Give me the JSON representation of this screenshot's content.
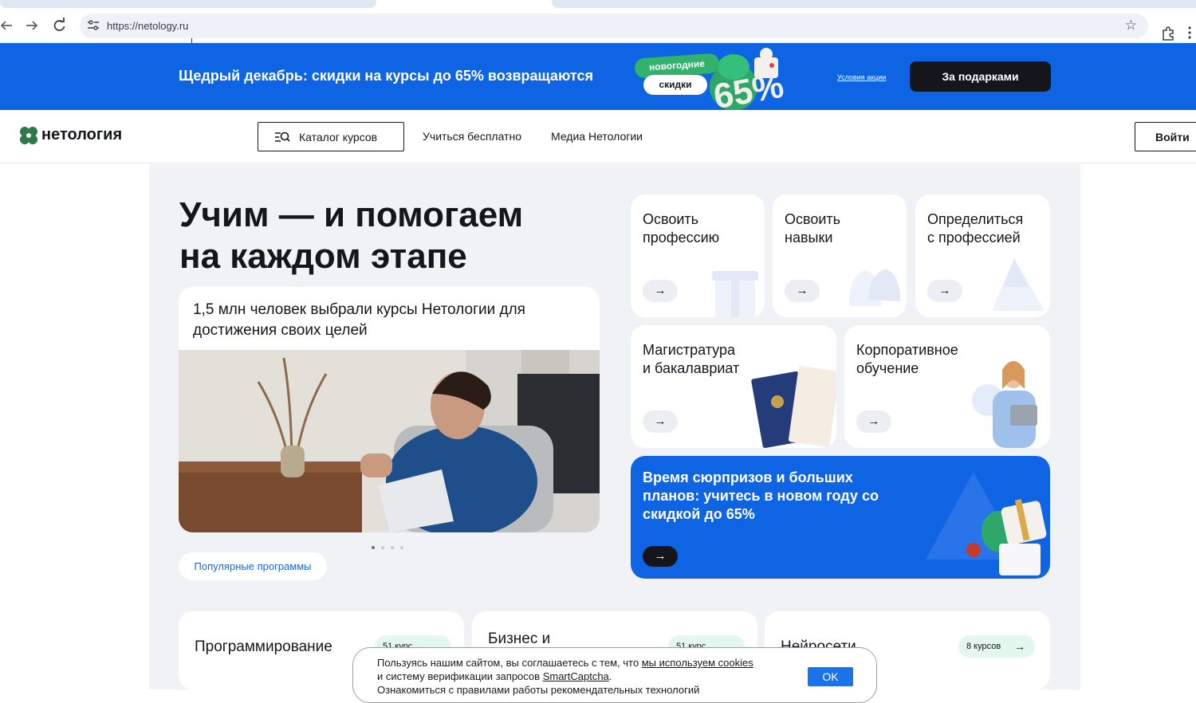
{
  "browser": {
    "url": "https://netology.ru",
    "icons": [
      "back-icon",
      "forward-icon",
      "reload-icon",
      "site-settings-icon",
      "bookmark-star-icon",
      "extensions-icon",
      "menu-icon"
    ]
  },
  "promo": {
    "text": "Щедрый декабрь: скидки на курсы до 65% возвращаются",
    "badge_top": "новогодние",
    "badge_bottom": "скидки",
    "badge_percent": "65%",
    "terms_link": "Условия акции",
    "cta": "За подарками",
    "color": "#0f64e3"
  },
  "header": {
    "logo_text": "нетология",
    "catalog_label": "Каталог курсов",
    "nav": [
      "Учиться бесплатно",
      "Медиа Нетологии"
    ],
    "login_label": "Войти"
  },
  "hero": {
    "title_line1": "Учим — и помогаем",
    "title_line2": "на каждом этапе",
    "card_text": "1,5 млн человек выбрали курсы Нетологии для достижения своих целей",
    "slider": {
      "count": 4,
      "active": 1
    },
    "popular_label": "Популярные программы"
  },
  "tiles": [
    {
      "title_1": "Освоить",
      "title_2": "профессию",
      "arrow": "→"
    },
    {
      "title_1": "Освоить",
      "title_2": "навыки",
      "arrow": "→"
    },
    {
      "title_1": "Определиться",
      "title_2": "с профессией",
      "arrow": "→"
    },
    {
      "title_1": "Магистратура",
      "title_2": "и бакалавриат",
      "arrow": "→"
    },
    {
      "title_1": "Корпоративное",
      "title_2": "обучение",
      "arrow": "→"
    }
  ],
  "promo_tile": {
    "text": "Время сюрпризов и больших планов: учитесь в новом году со скидкой до 65%",
    "arrow": "→"
  },
  "directions": [
    {
      "name": "Программирование",
      "count": "51 курс",
      "arrow": "→"
    },
    {
      "name": "Бизнес и",
      "count": "51 курс",
      "arrow": "→"
    },
    {
      "name": "Нейросети",
      "count": "8 курсов",
      "arrow": "→"
    }
  ],
  "cookie": {
    "line1_a": "Пользуясь нашим сайтом, вы соглашаетесь с тем, что ",
    "line1_link": "мы используем cookies",
    "line2_a": "и систему верификации запросов ",
    "line2_link": "SmartCaptcha",
    "line2_b": ".",
    "line3": "Ознакомиться с правилами работы рекомендательных технологий",
    "ok": "OK"
  }
}
